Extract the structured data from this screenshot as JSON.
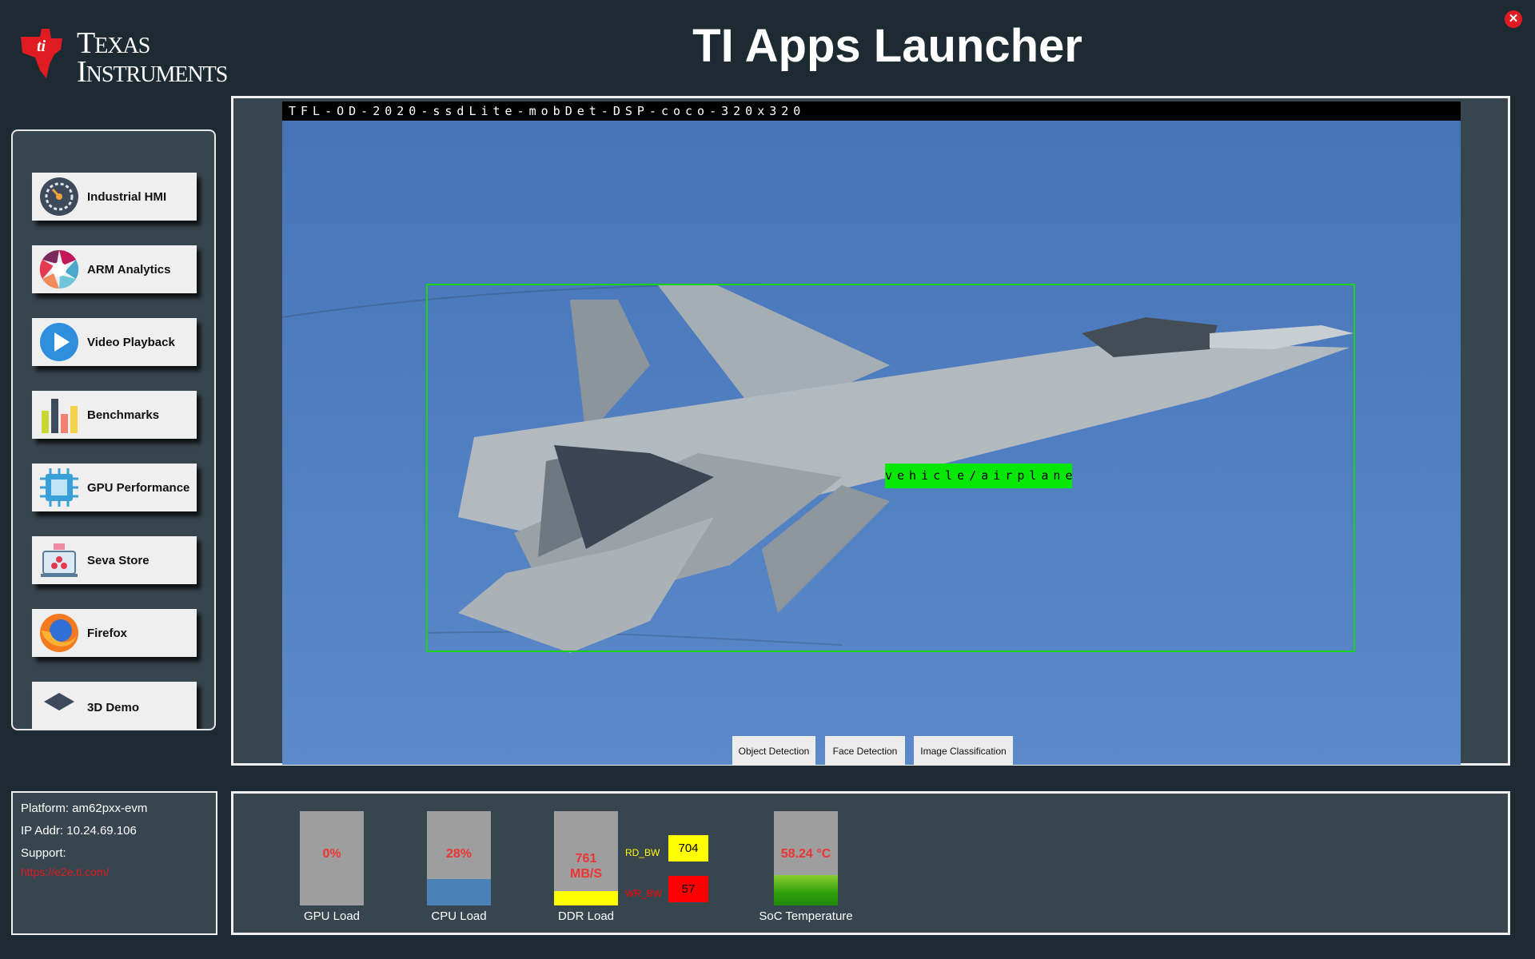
{
  "header": {
    "logo_line1": "Texas",
    "logo_line2": "Instruments",
    "title": "TI Apps Launcher"
  },
  "sidebar": {
    "items": [
      {
        "label": "Industrial HMI",
        "icon": "speedometer-icon"
      },
      {
        "label": "ARM Analytics",
        "icon": "aperture-icon"
      },
      {
        "label": "Video Playback",
        "icon": "play-icon"
      },
      {
        "label": "Benchmarks",
        "icon": "bar-chart-icon"
      },
      {
        "label": "GPU Performance",
        "icon": "chip-icon"
      },
      {
        "label": "Seva Store",
        "icon": "store-icon"
      },
      {
        "label": "Firefox",
        "icon": "firefox-icon"
      },
      {
        "label": "3D Demo",
        "icon": "cube-icon"
      }
    ]
  },
  "video": {
    "model_name": "TFL-OD-2020-ssdLite-mobDet-DSP-coco-320x320",
    "detection_label": "vehicle/airplane",
    "mode_buttons": [
      "Object Detection",
      "Face Detection",
      "Image Classification"
    ]
  },
  "info": {
    "platform": "Platform: am62pxx-evm",
    "ip": "IP Addr: 10.24.69.106",
    "support_label": "Support:",
    "support_link": "https://e2e.ti.com/"
  },
  "stats": {
    "gpu": {
      "label": "GPU Load",
      "value": "0%",
      "level": 0.0
    },
    "cpu": {
      "label": "CPU Load",
      "value": "28%",
      "level": 0.28
    },
    "ddr": {
      "label": "DDR Load",
      "value": "761",
      "unit": "MB/S",
      "level": 0.15,
      "rd_label": "RD_BW",
      "rd_value": "704",
      "wr_label": "WR_BW",
      "wr_value": "57"
    },
    "temp": {
      "label": "SoC Temperature",
      "value": "58.24 °C",
      "level": 0.32
    }
  },
  "colors": {
    "background": "#1d2a32",
    "panel": "#37454e",
    "ti_red": "#e01b22",
    "detection_green": "#08e808",
    "cpu_fill": "#4a82b8",
    "ddr_fill": "#ffff00",
    "wr_bw": "#ff0000",
    "temp_fill": "#2e9e0e"
  }
}
